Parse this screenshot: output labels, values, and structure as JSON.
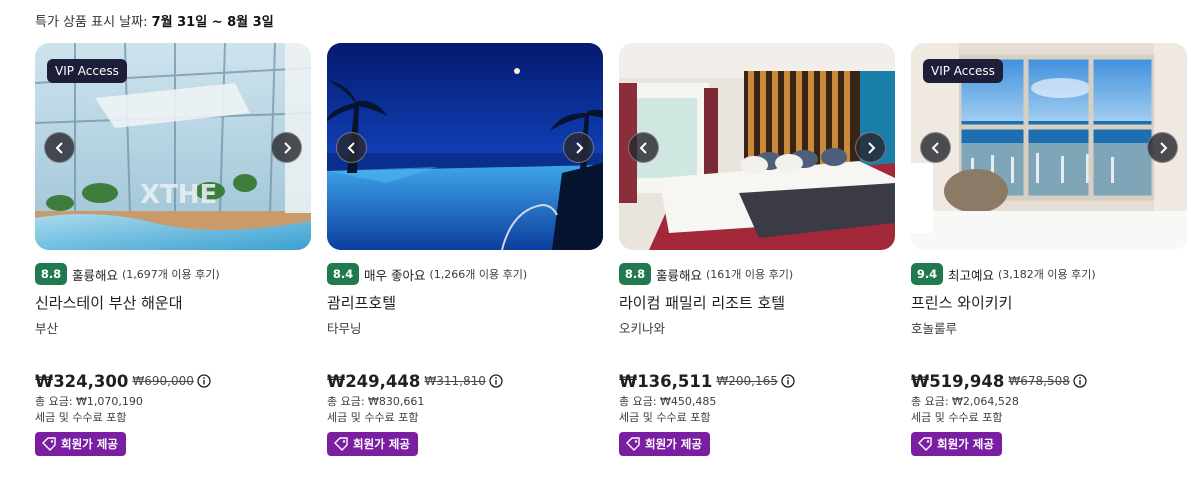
{
  "header": {
    "label": "특가 상품 표시 날짜:",
    "dates": "7월 31일 ~ 8월 3일"
  },
  "common": {
    "vip_label": "VIP Access",
    "tax_label": "세금 및 수수료 포함",
    "member_label": "회원가 제공",
    "icons": {
      "prev": "chevron-left-icon",
      "next": "chevron-right-icon",
      "info": "info-icon",
      "tag": "tag-icon"
    },
    "colors": {
      "score_bg": "#227950",
      "member_bg": "#7b1fa2",
      "vip_bg": "#1c1e3a"
    }
  },
  "hotels": [
    {
      "score": "8.8",
      "rating_text": "훌륭해요",
      "reviews": "(1,697개 이용 후기)",
      "name": "신라스테이 부산 해운대",
      "city": "부산",
      "price": "₩324,300",
      "old_price": "₩690,000",
      "total": "총 요금: ₩1,070,190",
      "vip": true
    },
    {
      "score": "8.4",
      "rating_text": "매우 좋아요",
      "reviews": "(1,266개 이용 후기)",
      "name": "괌리프호텔",
      "city": "타무닝",
      "price": "₩249,448",
      "old_price": "₩311,810",
      "total": "총 요금: ₩830,661",
      "vip": false
    },
    {
      "score": "8.8",
      "rating_text": "훌륭해요",
      "reviews": "(161개 이용 후기)",
      "name": "라이컴 패밀리 리조트 호텔",
      "city": "오키나와",
      "price": "₩136,511",
      "old_price": "₩200,165",
      "total": "총 요금: ₩450,485",
      "vip": false
    },
    {
      "score": "9.4",
      "rating_text": "최고예요",
      "reviews": "(3,182개 이용 후기)",
      "name": "프린스 와이키키",
      "city": "호놀룰루",
      "price": "₩519,948",
      "old_price": "₩678,508",
      "total": "총 요금: ₩2,064,528",
      "vip": true
    }
  ]
}
